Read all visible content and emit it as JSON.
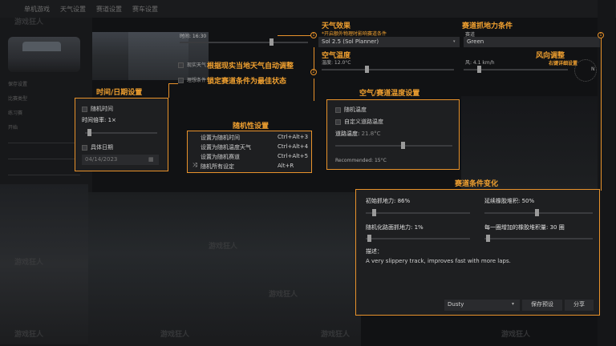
{
  "background": {
    "tabs": [
      "单机游戏",
      "天气设置",
      "赛道设置",
      "赛车设置"
    ],
    "time_label": "时间: 16:30",
    "time_value": "16:30",
    "labels": [
      "保存设置",
      "比赛类型",
      "练习赛",
      "开始"
    ],
    "date": "04/14/2023"
  },
  "weather_callout": {
    "title": "天气效果",
    "subtitle": "*开启额外物理时影响赛道条件",
    "marker": "1",
    "dropdown_value": "Sol 2.5 (Sol Planner)"
  },
  "grip_callout": {
    "title": "赛道抓地力条件",
    "field_label": "赛道",
    "dropdown_value": "Green",
    "marker": "1"
  },
  "realweather": {
    "checkbox_label": "现实天气",
    "annotation": "根据现实当地天气自动调整"
  },
  "ideal": {
    "checkbox_label": "理想条件",
    "annotation": "锁定赛道条件为最佳状态"
  },
  "airtemp_callout": {
    "title": "空气温度",
    "slider_label": "温度: 12.0°C",
    "marker": "2"
  },
  "wind_callout": {
    "title": "风向调整",
    "subtitle": "右键详细设置",
    "slider_label": "风: 4.1 km/h",
    "compass": "N"
  },
  "time_date": {
    "title": "时间/日期设置",
    "random_time": "随机时间",
    "time_rate": "时间倍率: 1×",
    "specific_date": "具体日期",
    "date_value": "04/14/2023"
  },
  "random": {
    "title": "随机性设置",
    "items": [
      {
        "label": "设置为随机时间",
        "shortcut": "Ctrl+Alt+3"
      },
      {
        "label": "设置为随机温度天气",
        "shortcut": "Ctrl+Alt+4"
      },
      {
        "label": "设置为随机赛道",
        "shortcut": "Ctrl+Alt+5"
      },
      {
        "label": "随机所有设定",
        "shortcut": "Alt+R"
      }
    ]
  },
  "airtrack": {
    "title": "空气/赛道温度设置",
    "random_temp": "随机温度",
    "custom_track_temp": "自定义道路温度",
    "road_temp_label": "道路温度:",
    "road_temp_value": "21.8°C",
    "recommended": "Recommended: 15°C"
  },
  "track_conditions": {
    "title": "赛道条件变化",
    "initial_grip": "初始抓地力: 86%",
    "rubber_extension": "延续橡胶堆积: 50%",
    "random_grip": "随机化路面抓地力: 1%",
    "rubber_per_lap": "每一圈增加的橡胶堆积量: 30 圈",
    "description_label": "描述：",
    "description": "A very slippery track, improves fast with more laps.",
    "preset_value": "Dusty",
    "save_preset": "保存预设",
    "share": "分享"
  },
  "watermark": "游戏狂人",
  "colors": {
    "accent": "#e8922b",
    "panel": "#1e1f21",
    "background": "#111214"
  }
}
